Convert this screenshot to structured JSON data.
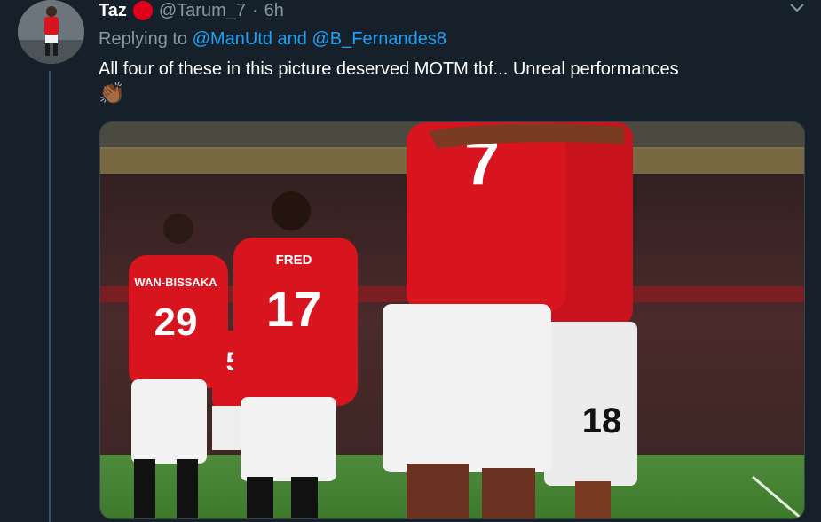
{
  "author": {
    "name": "Taz",
    "handle": "@Tarum_7",
    "separator": "·",
    "time": "6h"
  },
  "reply": {
    "prefix": "Replying to",
    "mention1": "@ManUtd",
    "and_text": "and",
    "mention2": "@B_Fernandes8"
  },
  "tweet": {
    "text": "All four of these in this picture deserved MOTM tbf... Unreal performances",
    "emoji": "👏🏾"
  },
  "media": {
    "jersey_numbers": {
      "left": "29",
      "center": "17",
      "back": "7",
      "right": "18",
      "partial": "5"
    },
    "jersey_names": {
      "left": "WAN-BISSAKA",
      "center": "FRED"
    }
  },
  "colors": {
    "background": "#15202b",
    "secondary_text": "#8899a6",
    "link": "#1da1f2",
    "kit_red": "#d8141e"
  },
  "icons": {
    "menu": "chevron-down-icon",
    "badge": "red-circle-badge"
  }
}
